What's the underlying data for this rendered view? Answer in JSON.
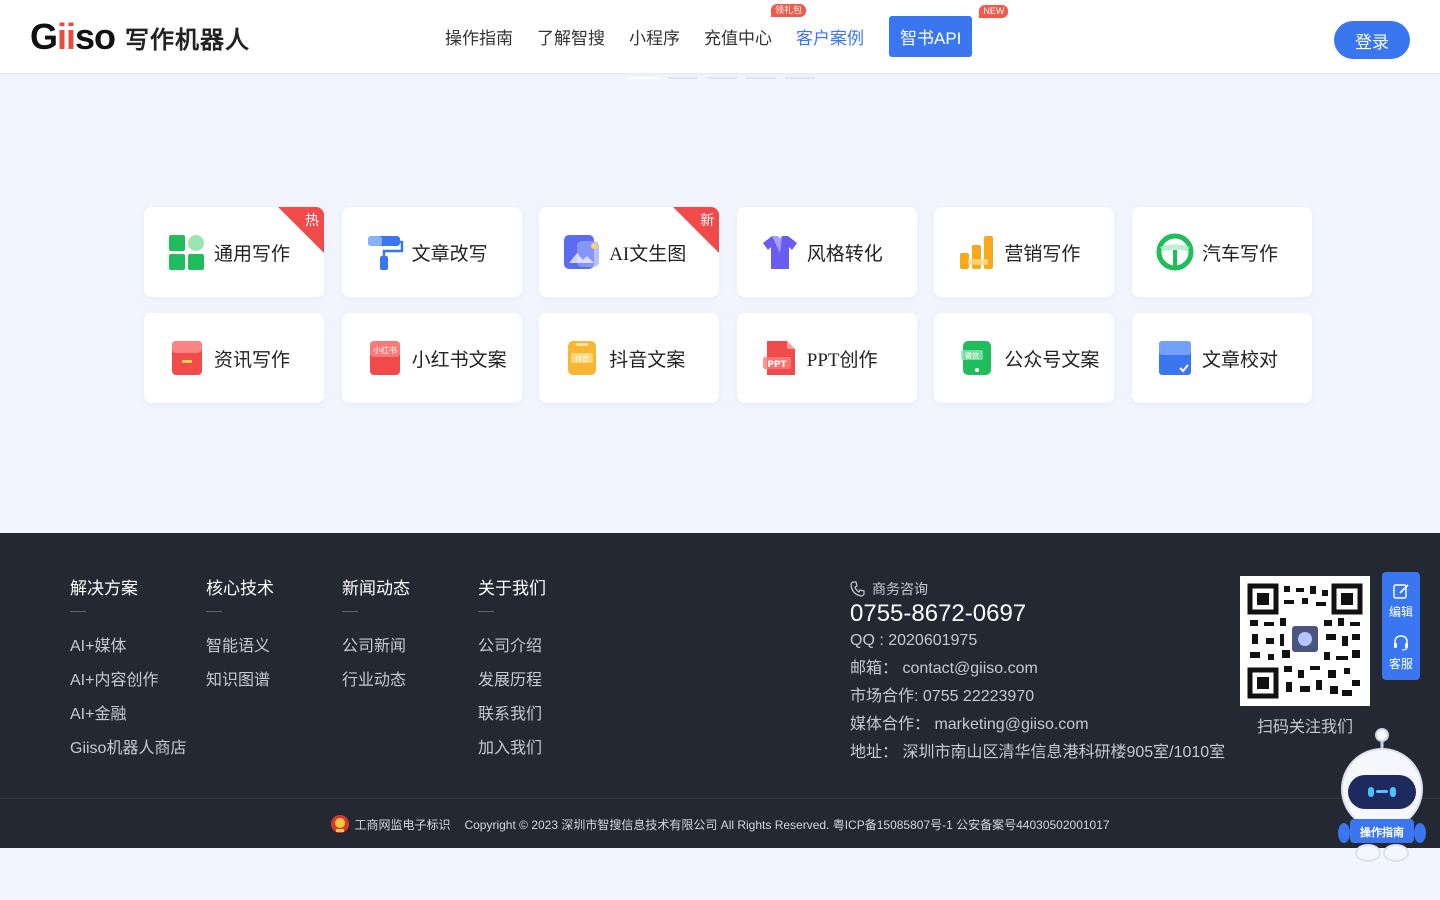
{
  "header": {
    "logo_mark": "Giiso",
    "logo_text": "写作机器人",
    "nav": [
      {
        "label": "操作指南"
      },
      {
        "label": "了解智搜"
      },
      {
        "label": "小程序"
      },
      {
        "label": "充值中心",
        "badge": "领礼包"
      },
      {
        "label": "客户案例",
        "active": true
      }
    ],
    "api_label": "智书API",
    "api_badge": "NEW",
    "login_label": "登录"
  },
  "cards": [
    {
      "label": "通用写作",
      "icon": "grid-blocks-icon",
      "corner": "热"
    },
    {
      "label": "文章改写",
      "icon": "paint-roller-icon"
    },
    {
      "label": "AI文生图",
      "icon": "image-gen-icon",
      "corner": "新"
    },
    {
      "label": "风格转化",
      "icon": "shirt-icon"
    },
    {
      "label": "营销写作",
      "icon": "bar-chart-icon"
    },
    {
      "label": "汽车写作",
      "icon": "steering-wheel-icon"
    },
    {
      "label": "资讯写作",
      "icon": "news-book-icon"
    },
    {
      "label": "小红书文案",
      "icon": "xiaohongshu-icon",
      "icon_text": "小红书"
    },
    {
      "label": "抖音文案",
      "icon": "douyin-phone-icon",
      "icon_text": "抖音"
    },
    {
      "label": "PPT创作",
      "icon": "ppt-file-icon",
      "icon_text": "PPT"
    },
    {
      "label": "公众号文案",
      "icon": "wechat-phone-icon",
      "icon_text": "微信"
    },
    {
      "label": "文章校对",
      "icon": "proofread-check-icon"
    }
  ],
  "footer": {
    "columns": [
      {
        "title": "解决方案",
        "links": [
          "AI+媒体",
          "AI+内容创作",
          "AI+金融",
          "Giiso机器人商店"
        ]
      },
      {
        "title": "核心技术",
        "links": [
          "智能语义",
          "知识图谱"
        ]
      },
      {
        "title": "新闻动态",
        "links": [
          "公司新闻",
          "行业动态"
        ]
      },
      {
        "title": "关于我们",
        "links": [
          "公司介绍",
          "发展历程",
          "联系我们",
          "加入我们"
        ]
      }
    ],
    "contact": {
      "biz_label": "商务咨询",
      "phone": "0755-8672-0697",
      "qq": "QQ : 2020601975",
      "email": "邮箱： contact@giiso.com",
      "market": "市场合作: 0755 22223970",
      "media": "媒体合作： marketing@giiso.com",
      "address": "地址： 深圳市南山区清华信息港科研楼905室/1010室"
    },
    "qr_label": "扫码关注我们",
    "bottom": {
      "emblem_label": "工商网监电子标识",
      "copyright": "Copyright © 2023 深圳市智搜信息技术有限公司 All Rights Reserved. 粤ICP备15085807号-1 公安备案号44030502001017"
    }
  },
  "side_tools": {
    "edit_label": "编辑",
    "service_label": "客服"
  },
  "robot_label": "操作指南",
  "colors": {
    "accent": "#3a76f0",
    "hot": "#f04a4a",
    "footer_bg": "#242833",
    "page_bg": "#f2f5fd"
  }
}
